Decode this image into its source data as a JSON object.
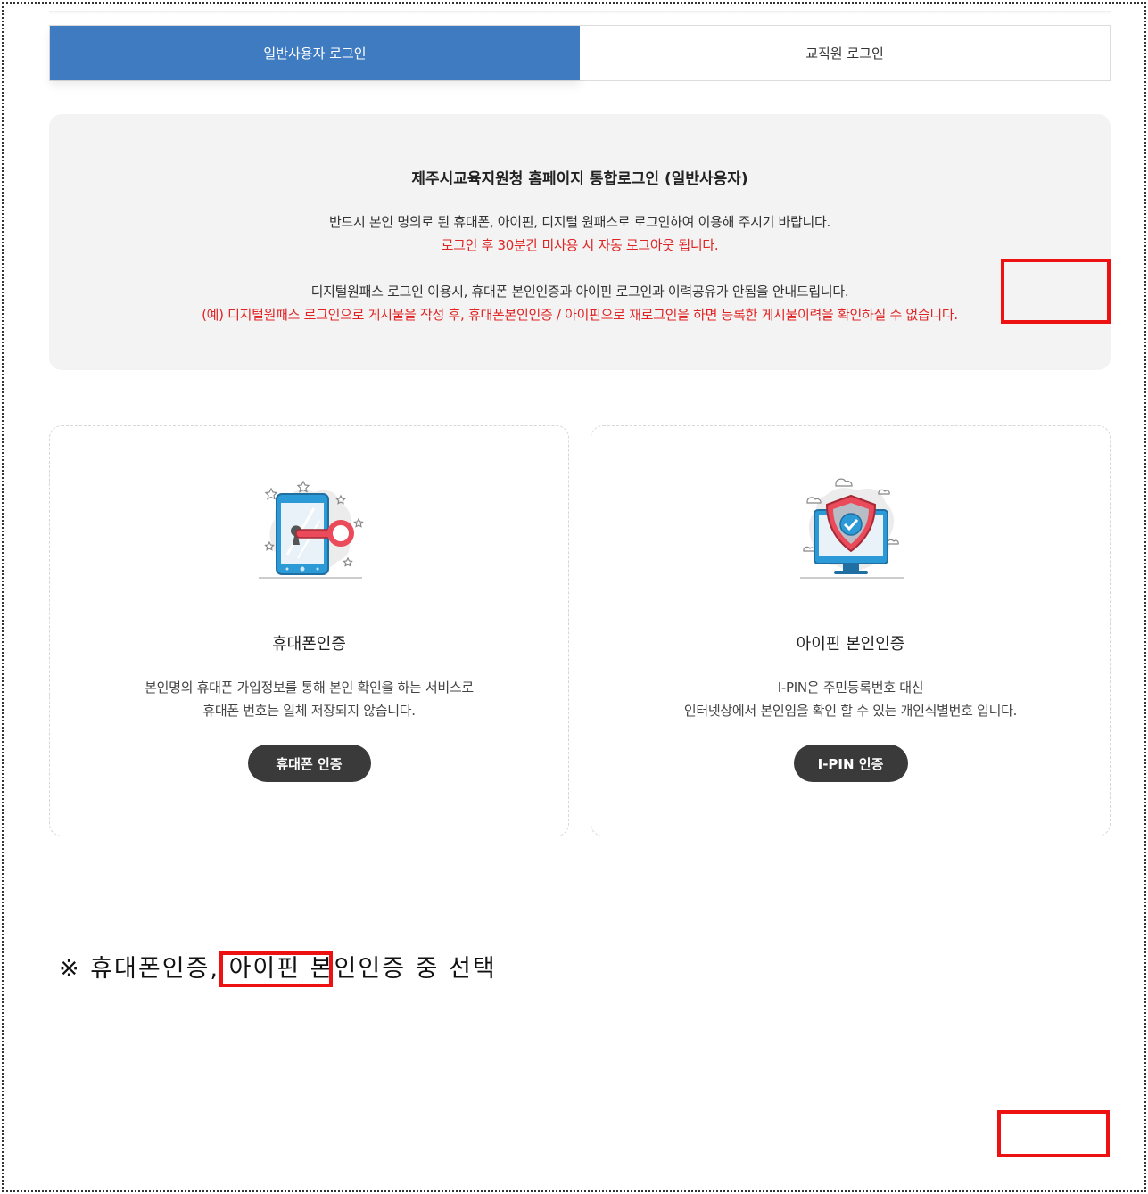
{
  "tabs": [
    {
      "label": "일반사용자 로그인",
      "active": true
    },
    {
      "label": "교직원 로그인",
      "active": false
    }
  ],
  "notice": {
    "title": "제주시교육지원청 홈페이지 통합로그인 (일반사용자)",
    "line1": "반드시 본인 명의로 된 휴대폰, 아이핀, 디지털 원패스로 로그인하여 이용해 주시기 바랍니다.",
    "line2": "로그인 후 30분간 미사용 시 자동 로그아웃 됩니다.",
    "line3": "디지털원패스 로그인 이용시, 휴대폰 본인인증과 아이핀 로그인과 이력공유가 안됨을 안내드립니다.",
    "line4": "(예) 디지털원패스 로그인으로 게시물을 작성 후, 휴대폰본인인증 / 아이핀으로 재로그인을 하면 등록한 게시물이력을 확인하실 수 없습니다."
  },
  "cards": [
    {
      "icon": "phone-key-icon",
      "title": "휴대폰인증",
      "desc1": "본인명의 휴대폰 가입정보를 통해 본인 확인을 하는 서비스로",
      "desc2": "휴대폰 번호는 일체 저장되지 않습니다.",
      "button": "휴대폰 인증"
    },
    {
      "icon": "shield-monitor-icon",
      "title": "아이핀 본인인증",
      "desc1": "I-PIN은 주민등록번호 대신",
      "desc2": "인터넷상에서 본인임을 확인 할 수 있는 개인식별번호 입니다.",
      "button": "I-PIN 인증"
    }
  ],
  "footnote": "※ 휴대폰인증, 아이핀 본인인증 중 선택",
  "colors": {
    "active_tab": "#3f7bc1",
    "warning_text": "#e02424",
    "button_bg": "#3a3a3a",
    "annotation_box": "#ee1111"
  }
}
